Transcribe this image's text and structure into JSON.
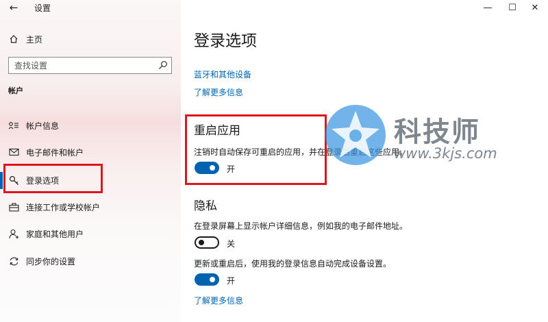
{
  "window": {
    "title": "设置",
    "controls": {
      "minimize": "—",
      "maximize": "☐",
      "close": "✕"
    },
    "back_glyph": "←"
  },
  "sidebar": {
    "home": {
      "icon": "home-icon",
      "label": "主页"
    },
    "search": {
      "placeholder": "查找设置",
      "icon": "search-icon"
    },
    "section": "帐户",
    "items": [
      {
        "icon": "person-list-icon",
        "label": "帐户信息"
      },
      {
        "icon": "mail-icon",
        "label": "电子邮件和帐户"
      },
      {
        "icon": "key-icon",
        "label": "登录选项",
        "selected": true
      },
      {
        "icon": "briefcase-icon",
        "label": "连接工作或学校帐户"
      },
      {
        "icon": "add-person-icon",
        "label": "家庭和其他用户"
      },
      {
        "icon": "sync-icon",
        "label": "同步你的设置"
      }
    ]
  },
  "main": {
    "title": "登录选项",
    "bluetooth_link": "蓝牙和其他设备",
    "learn_more_link_1": "了解更多信息",
    "restart_apps": {
      "title": "重启应用",
      "description": "注销时自动保存可重启的应用，并在登录后重启这些应用。",
      "toggle_state": "on",
      "toggle_label": "开"
    },
    "privacy": {
      "title": "隐私",
      "setting_1": {
        "description": "在登录屏幕上显示帐户详细信息，例如我的电子邮件地址。",
        "toggle_state": "off",
        "toggle_label": "关"
      },
      "setting_2": {
        "description": "更新或重启后，使用我的登录信息自动完成设备设置。",
        "toggle_state": "on",
        "toggle_label": "开"
      },
      "learn_more_link": "了解更多信息"
    }
  },
  "watermark": {
    "name": "科技师",
    "url": "www.3kjs.com"
  },
  "colors": {
    "accent": "#0063b1",
    "highlight_box": "#e0151b",
    "sidebar_bg": "#f8eded"
  }
}
